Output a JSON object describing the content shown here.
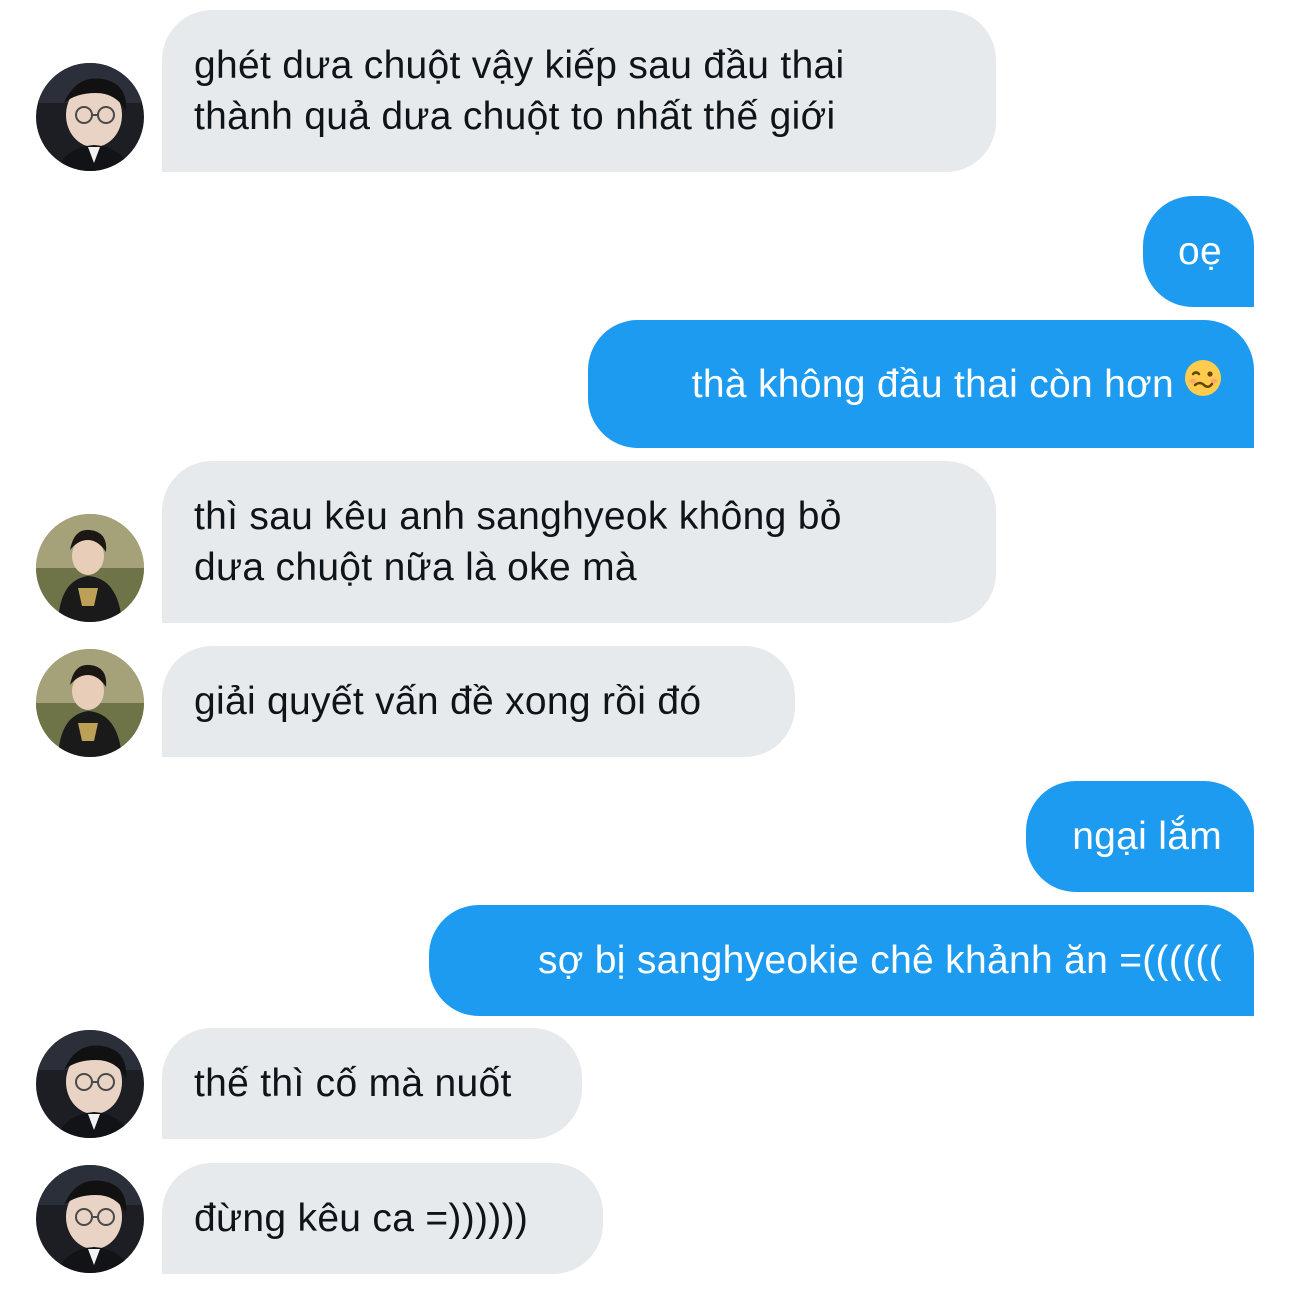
{
  "conversation": {
    "messages": [
      {
        "sender": "them",
        "avatar": "avatar-suit-glasses",
        "lines": [
          "ghét dưa chuột vậy kiếp sau đầu thai",
          "thành quả dưa chuột to nhất thế giới"
        ]
      },
      {
        "sender": "me",
        "text": "oẹ"
      },
      {
        "sender": "me",
        "text": "thà không đầu thai còn hơn",
        "emoji": "woozy-face-icon"
      },
      {
        "sender": "them",
        "avatar": "avatar-jersey-outdoor",
        "lines": [
          "thì sau kêu anh sanghyeok không bỏ",
          "dưa chuột nữa là oke mà"
        ]
      },
      {
        "sender": "them",
        "avatar": "avatar-jersey-outdoor",
        "text": "giải quyết vấn đề xong rồi đó"
      },
      {
        "sender": "me",
        "text": "ngại lắm"
      },
      {
        "sender": "me",
        "text": "sợ bị sanghyeokie chê khảnh ăn =(((((("
      },
      {
        "sender": "them",
        "avatar": "avatar-suit-glasses",
        "text": "thế thì cố mà nuốt"
      },
      {
        "sender": "them",
        "avatar": "avatar-suit-glasses",
        "text": "đừng kêu ca =))))))"
      }
    ]
  },
  "colors": {
    "incoming_bubble": "#e7eaed",
    "outgoing_bubble": "#1d9bf0",
    "incoming_text": "#0f1419",
    "outgoing_text": "#ffffff"
  }
}
